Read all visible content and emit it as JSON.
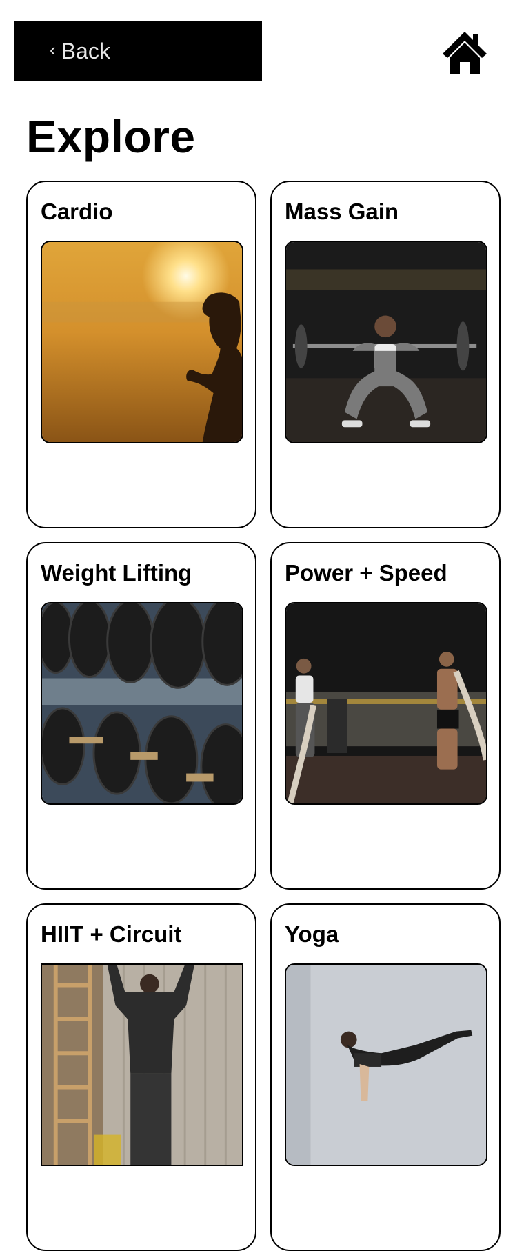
{
  "header": {
    "back_label": "Back",
    "back_icon": "chevron-left-icon",
    "home_icon": "home-icon"
  },
  "page": {
    "title": "Explore"
  },
  "categories": [
    {
      "label": "Cardio",
      "image": "runner-silhouette-sunset"
    },
    {
      "label": "Mass Gain",
      "image": "woman-barbell-squat"
    },
    {
      "label": "Weight Lifting",
      "image": "dumbbell-rack"
    },
    {
      "label": "Power + Speed",
      "image": "battle-ropes-gym"
    },
    {
      "label": "HIIT + Circuit",
      "image": "man-stretching-wall-bars"
    },
    {
      "label": "Yoga",
      "image": "woman-yoga-pose"
    }
  ],
  "colors": {
    "primary": "#000000",
    "background": "#ffffff",
    "back_text": "#e8e8e8"
  }
}
